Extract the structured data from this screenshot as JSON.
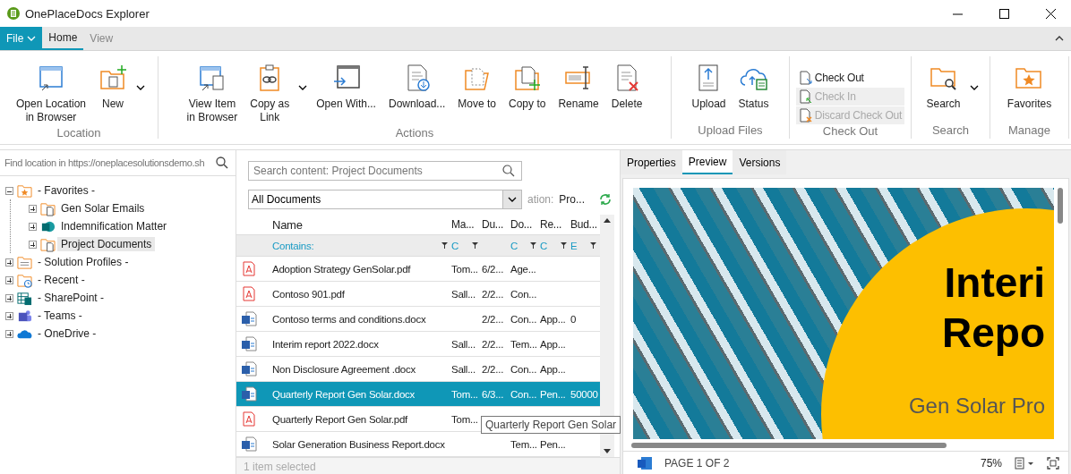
{
  "window": {
    "title": "OnePlaceDocs Explorer"
  },
  "ribbon": {
    "tabs": [
      {
        "label": "File",
        "kind": "file",
        "selected": false
      },
      {
        "label": "Home",
        "kind": "tab",
        "selected": true
      },
      {
        "label": "View",
        "kind": "tab",
        "selected": false
      }
    ],
    "groups": [
      {
        "label": "Location",
        "buttons": [
          {
            "label": "Open Location\nin Browser",
            "kind": "open-location",
            "dropdown": false
          },
          {
            "label": "New",
            "kind": "new-folder",
            "dropdown": true
          }
        ]
      },
      {
        "label": "Actions",
        "buttons": [
          {
            "label": "View Item\nin Browser",
            "kind": "view-item",
            "dropdown": false
          },
          {
            "label": "Copy as\nLink",
            "kind": "copy-link",
            "dropdown": true
          },
          {
            "label": "Open  With...",
            "kind": "open-with",
            "dropdown": false
          },
          {
            "label": "Download...",
            "kind": "download",
            "dropdown": false
          },
          {
            "label": "Move to",
            "kind": "move-to",
            "dropdown": false
          },
          {
            "label": "Copy to",
            "kind": "copy-to",
            "dropdown": false
          },
          {
            "label": "Rename",
            "kind": "rename",
            "dropdown": false
          },
          {
            "label": "Delete",
            "kind": "delete",
            "dropdown": false
          }
        ]
      },
      {
        "label": "Upload Files",
        "buttons": [
          {
            "label": "Upload",
            "kind": "upload",
            "dropdown": false
          },
          {
            "label": "Status",
            "kind": "status",
            "dropdown": false
          }
        ]
      },
      {
        "label": "Check Out",
        "small_buttons": [
          {
            "label": "Check Out",
            "kind": "check-out",
            "disabled": false
          },
          {
            "label": "Check In",
            "kind": "check-in",
            "disabled": true
          },
          {
            "label": "Discard Check Out",
            "kind": "discard",
            "disabled": true
          }
        ]
      },
      {
        "label": "Search",
        "buttons": [
          {
            "label": "Search",
            "kind": "search-folder",
            "dropdown": true
          }
        ]
      },
      {
        "label": "Manage",
        "buttons": [
          {
            "label": "Favorites",
            "kind": "favorites",
            "dropdown": false
          }
        ]
      }
    ]
  },
  "location_search": {
    "placeholder": "Find location in https://oneplacesolutionsdemo.sh"
  },
  "tree": [
    {
      "label": "- Favorites -",
      "kind": "favorites",
      "expanded": true,
      "selected": false,
      "children": [
        {
          "label": "Gen Solar Emails",
          "kind": "library",
          "expanded": false,
          "selected": false
        },
        {
          "label": "Indemnification Matter",
          "kind": "site",
          "expanded": false,
          "selected": false
        },
        {
          "label": "Project Documents",
          "kind": "library",
          "expanded": false,
          "selected": true
        }
      ]
    },
    {
      "label": "- Solution Profiles -",
      "kind": "profiles",
      "expanded": false,
      "selected": false
    },
    {
      "label": "- Recent -",
      "kind": "recent",
      "expanded": false,
      "selected": false
    },
    {
      "label": "- SharePoint -",
      "kind": "sharepoint",
      "expanded": false,
      "selected": false
    },
    {
      "label": "- Teams -",
      "kind": "teams",
      "expanded": false,
      "selected": false
    },
    {
      "label": "- OneDrive -",
      "kind": "onedrive",
      "expanded": false,
      "selected": false
    }
  ],
  "documents": {
    "search": {
      "placeholder": "Search content: Project Documents"
    },
    "view": {
      "value": "All Documents"
    },
    "location": {
      "label": "ation:",
      "value": "Pro..."
    },
    "columns": [
      "Name",
      "Ma...",
      "Du...",
      "Do...",
      "Re...",
      "Bud..."
    ],
    "filters": [
      {
        "label": "Contains:",
        "filter_icon": true
      },
      {
        "label": "C",
        "filter_icon": true
      },
      {
        "filter_icon": false
      },
      {
        "label": "C",
        "filter_icon": true
      },
      {
        "label": "C",
        "filter_icon": true
      },
      {
        "label": "E",
        "filter_icon": true
      }
    ],
    "rows": [
      {
        "kind": "pdf",
        "cells": [
          "Adoption Strategy GenSolar.pdf",
          "Tom...",
          "6/2...",
          "Age...",
          "",
          ""
        ],
        "selected": false
      },
      {
        "kind": "pdf",
        "cells": [
          "Contoso 901.pdf",
          "Sall...",
          "2/2...",
          "Con...",
          "",
          ""
        ],
        "selected": false
      },
      {
        "kind": "word",
        "cells": [
          "Contoso terms and conditions.docx",
          "",
          "2/2...",
          "Con...",
          "App...",
          "0"
        ],
        "selected": false
      },
      {
        "kind": "word",
        "cells": [
          "Interim report 2022.docx",
          "Sall...",
          "2/2...",
          "Tem...",
          "App...",
          ""
        ],
        "selected": false
      },
      {
        "kind": "word",
        "cells": [
          "Non Disclosure Agreement .docx",
          "Sall...",
          "2/2...",
          "Con...",
          "App...",
          ""
        ],
        "selected": false
      },
      {
        "kind": "word",
        "cells": [
          "Quarterly Report Gen Solar.docx",
          "Tom...",
          "6/3...",
          "Con...",
          "Pen...",
          "50000"
        ],
        "selected": true
      },
      {
        "kind": "pdf",
        "cells": [
          "Quarterly Report Gen Solar.pdf",
          "Tom...",
          "",
          "",
          "",
          ""
        ],
        "selected": false
      },
      {
        "kind": "word",
        "cells": [
          "Solar Generation Business Report.docx",
          "",
          "",
          "Tem...",
          "Pen...",
          ""
        ],
        "selected": false
      }
    ],
    "tooltip": "Quarterly Report Gen Solar",
    "status": "1 item selected"
  },
  "preview": {
    "tabs": [
      {
        "label": "Properties",
        "selected": false
      },
      {
        "label": "Preview",
        "selected": true
      },
      {
        "label": "Versions",
        "selected": false
      }
    ],
    "slide": {
      "title_lines": [
        "Interi",
        "Repo"
      ],
      "subtitle": "Gen Solar Pro"
    },
    "page": "PAGE 1 OF 2",
    "zoom": "75%"
  }
}
